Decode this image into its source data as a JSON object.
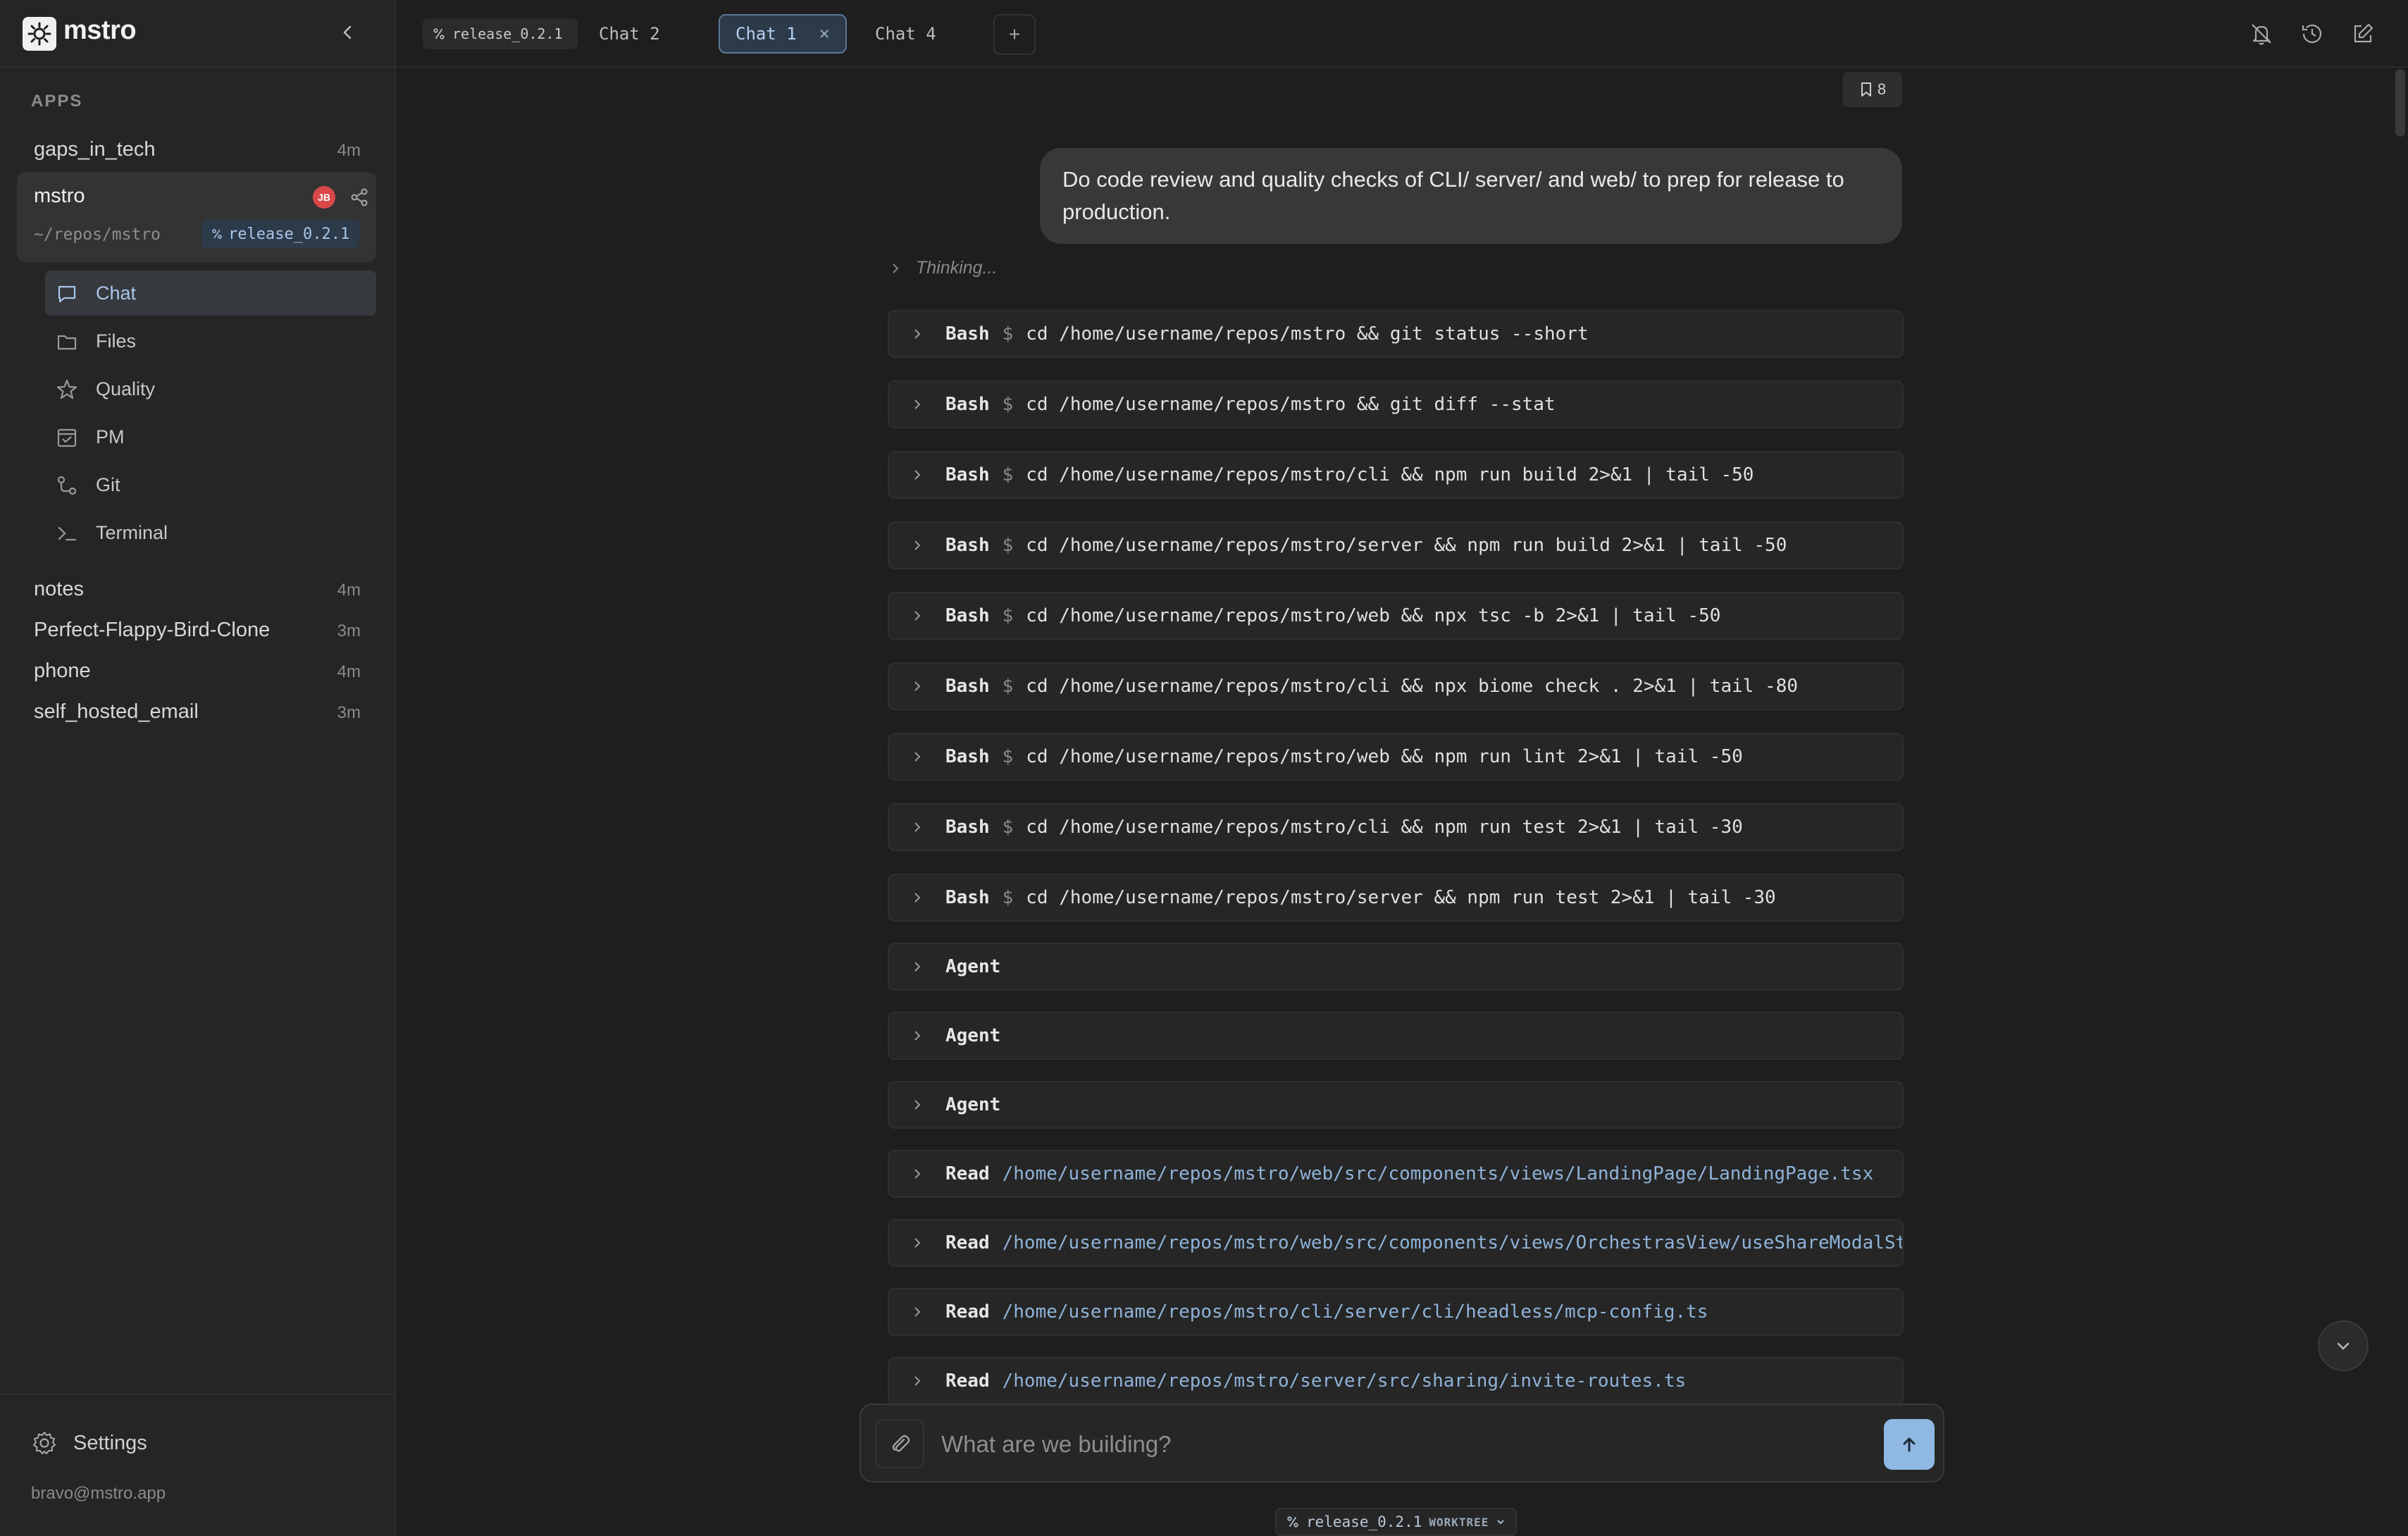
{
  "app": {
    "name": "mstro",
    "section_label": "APPS"
  },
  "sidebar": {
    "apps_before": [
      {
        "name": "gaps_in_tech",
        "time": "4m"
      }
    ],
    "active_app": {
      "name": "mstro",
      "avatar_initials": "JB",
      "path": "~/repos/mstro",
      "branch": "release_0.2.1"
    },
    "nav": [
      {
        "label": "Chat",
        "icon": "chat-icon"
      },
      {
        "label": "Files",
        "icon": "folder-icon"
      },
      {
        "label": "Quality",
        "icon": "star-icon"
      },
      {
        "label": "PM",
        "icon": "calendar-icon"
      },
      {
        "label": "Git",
        "icon": "git-icon"
      },
      {
        "label": "Terminal",
        "icon": "terminal-icon"
      }
    ],
    "apps_after": [
      {
        "name": "notes",
        "time": "4m"
      },
      {
        "name": "Perfect-Flappy-Bird-Clone",
        "time": "3m"
      },
      {
        "name": "phone",
        "time": "4m"
      },
      {
        "name": "self_hosted_email",
        "time": "3m"
      }
    ],
    "settings_label": "Settings",
    "user_email": "bravo@mstro.app"
  },
  "tabs": {
    "branch_tab": "release_0.2.1",
    "chat2": "Chat 2",
    "chat1": "Chat 1",
    "chat1_close": "×",
    "chat4": "Chat 4",
    "add": "+"
  },
  "chat": {
    "bookmark_count": "8",
    "user_message": "Do code review and quality checks of CLI/ server/ and web/ to prep for release to production.",
    "thinking": "Thinking...",
    "tools": [
      {
        "name": "Bash",
        "dollar": "$",
        "cmd": "cd /home/username/repos/mstro && git status --short"
      },
      {
        "name": "Bash",
        "dollar": "$",
        "cmd": "cd /home/username/repos/mstro && git diff --stat"
      },
      {
        "name": "Bash",
        "dollar": "$",
        "cmd": "cd /home/username/repos/mstro/cli && npm run build 2>&1 | tail -50"
      },
      {
        "name": "Bash",
        "dollar": "$",
        "cmd": "cd /home/username/repos/mstro/server && npm run build 2>&1 | tail -50"
      },
      {
        "name": "Bash",
        "dollar": "$",
        "cmd": "cd /home/username/repos/mstro/web && npx tsc -b 2>&1 | tail -50"
      },
      {
        "name": "Bash",
        "dollar": "$",
        "cmd": "cd /home/username/repos/mstro/cli && npx biome check . 2>&1 | tail -80"
      },
      {
        "name": "Bash",
        "dollar": "$",
        "cmd": "cd /home/username/repos/mstro/web && npm run lint 2>&1 | tail -50"
      },
      {
        "name": "Bash",
        "dollar": "$",
        "cmd": "cd /home/username/repos/mstro/cli && npm run test 2>&1 | tail -30"
      },
      {
        "name": "Bash",
        "dollar": "$",
        "cmd": "cd /home/username/repos/mstro/server && npm run test 2>&1 | tail -30"
      },
      {
        "name": "Agent"
      },
      {
        "name": "Agent"
      },
      {
        "name": "Agent"
      },
      {
        "name": "Read",
        "path": "/home/username/repos/mstro/web/src/components/views/LandingPage/LandingPage.tsx"
      },
      {
        "name": "Read",
        "path": "/home/username/repos/mstro/web/src/components/views/OrchestrasView/useShareModalState.ts"
      },
      {
        "name": "Read",
        "path": "/home/username/repos/mstro/cli/server/cli/headless/mcp-config.ts"
      },
      {
        "name": "Read",
        "path": "/home/username/repos/mstro/server/src/sharing/invite-routes.ts"
      }
    ]
  },
  "composer": {
    "placeholder": "What are we building?"
  },
  "footer": {
    "branch": "release_0.2.1",
    "worktree_label": "WORKTREE"
  },
  "colors": {
    "accent": "#8fb8e3",
    "branch_bg": "#2d3a4a",
    "avatar": "#d94848"
  }
}
